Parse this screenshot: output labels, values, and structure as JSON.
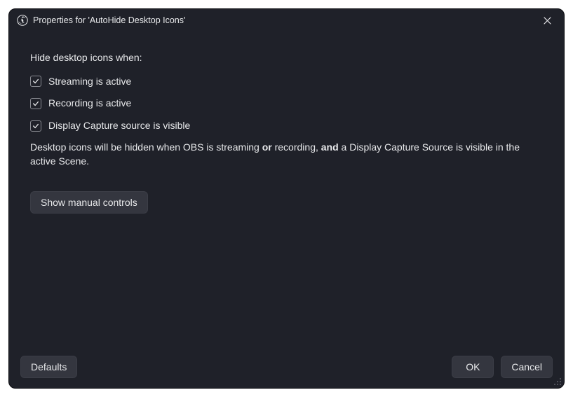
{
  "window": {
    "title": "Properties for 'AutoHide Desktop Icons'",
    "app_icon": "obs-icon",
    "close_icon": "close-icon"
  },
  "content": {
    "heading": "Hide desktop icons when:",
    "checks": [
      {
        "label": "Streaming is active",
        "checked": true
      },
      {
        "label": "Recording is active",
        "checked": true
      },
      {
        "label": "Display Capture source is visible",
        "checked": true
      }
    ],
    "description_parts": {
      "pre": "Desktop icons will be hidden when OBS is streaming ",
      "b1": "or",
      "mid": " recording, ",
      "b2": "and",
      "post": " a Display Capture Source is visible in the active Scene."
    },
    "manual_button": "Show manual controls"
  },
  "footer": {
    "defaults": "Defaults",
    "ok": "OK",
    "cancel": "Cancel"
  }
}
